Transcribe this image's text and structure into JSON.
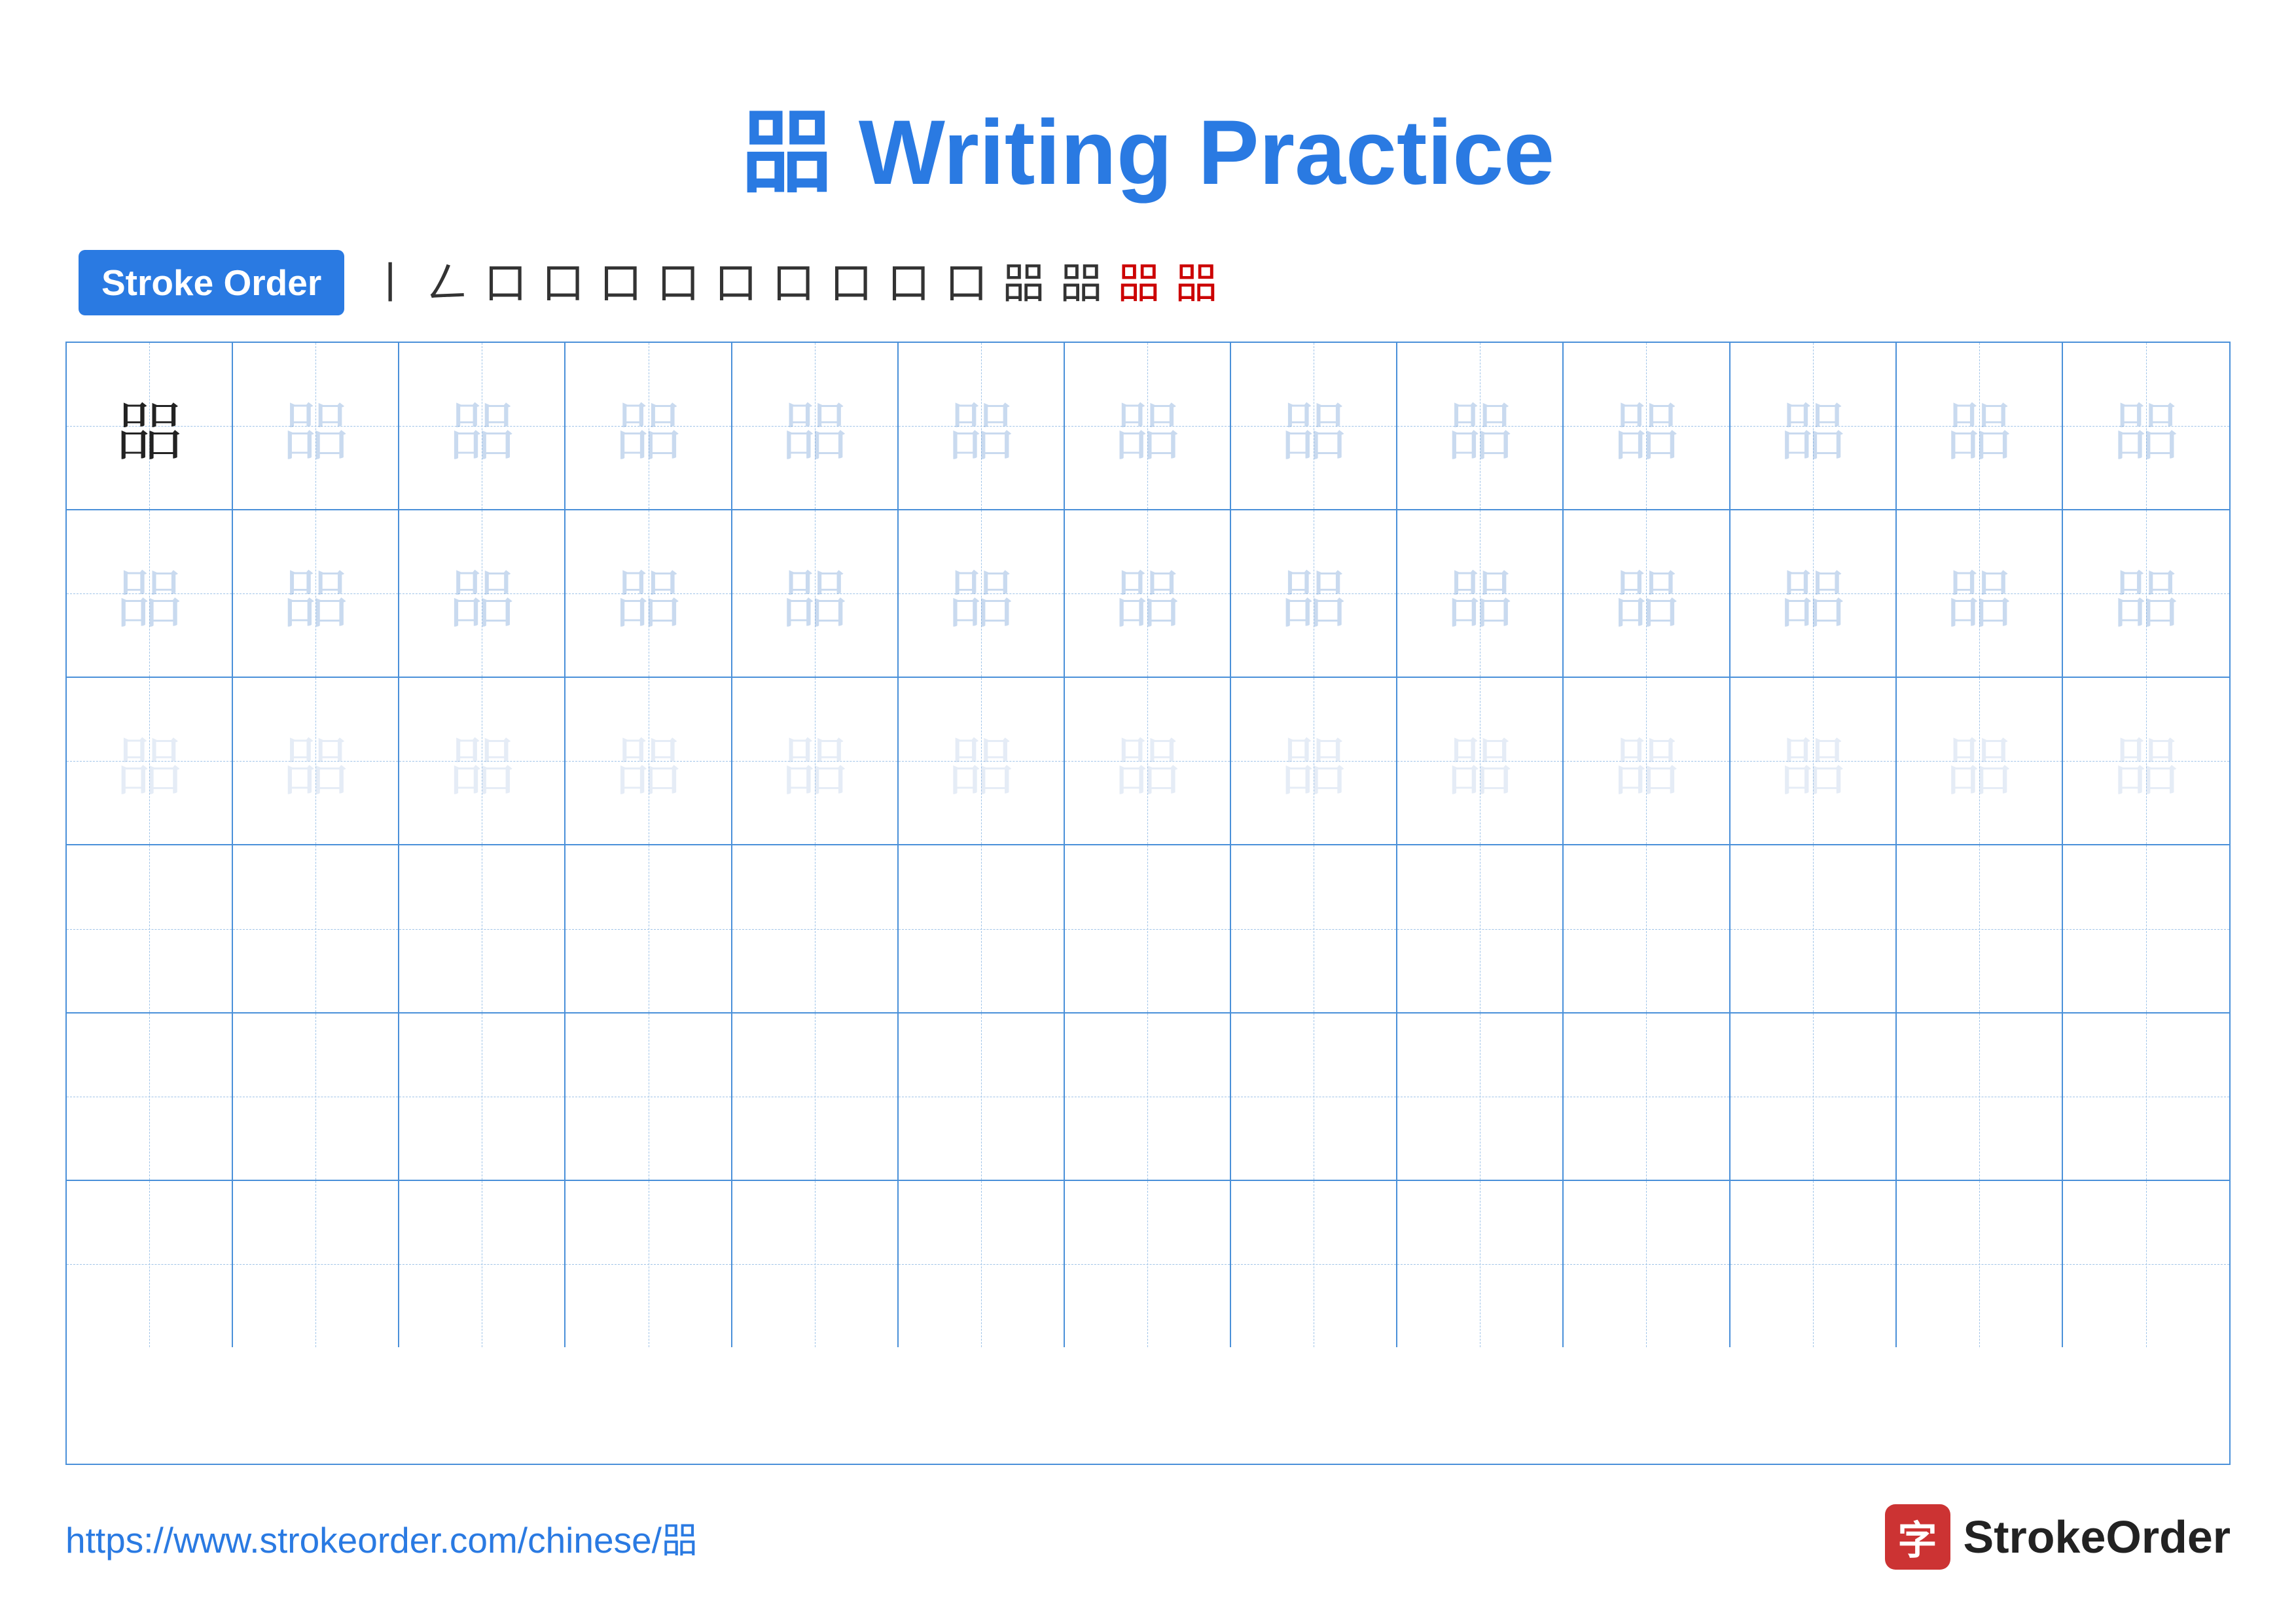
{
  "page": {
    "title": "㗊 Writing Practice",
    "title_char": "㗊",
    "title_suffix": " Writing Practice",
    "accent_color": "#2a7ae2",
    "background": "#ffffff"
  },
  "stroke_order": {
    "badge_label": "Stroke Order",
    "steps": [
      "丨",
      "𠃋",
      "口",
      "口一",
      "口⊤",
      "口⊤",
      "口⊤日",
      "口㗊₅",
      "口㗊₆",
      "口㗊₇",
      "㗊₈",
      "㗊₉",
      "㗊₁₀",
      "㗊₁₁",
      "㗊"
    ]
  },
  "grid": {
    "rows": 6,
    "cols": 13,
    "char": "㗊",
    "row1_type": "solid_then_faded",
    "row2_type": "faded",
    "row3_type": "lighter",
    "row4_type": "empty",
    "row5_type": "empty",
    "row6_type": "empty"
  },
  "footer": {
    "url": "https://www.strokeorder.com/chinese/㗊",
    "logo_icon": "字",
    "logo_text": "StrokeOrder"
  }
}
